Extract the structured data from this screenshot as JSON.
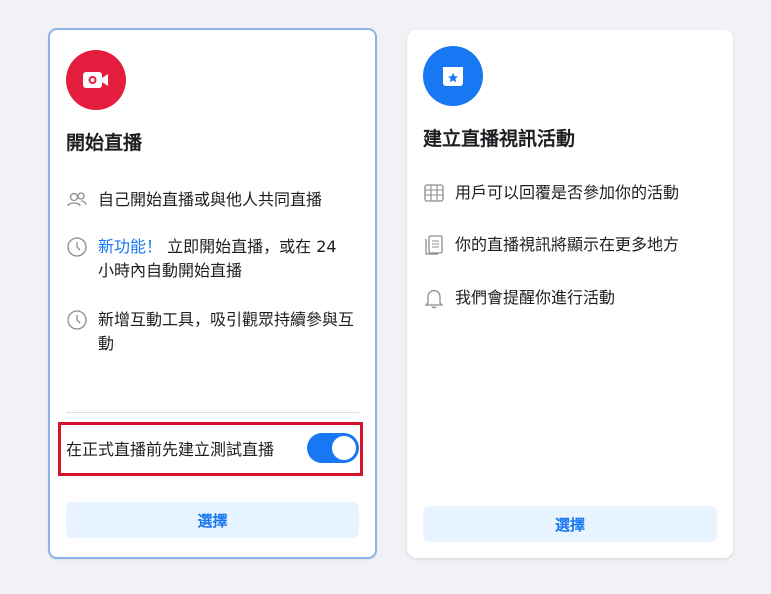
{
  "left_card": {
    "title": "開始直播",
    "features": [
      {
        "icon": "people-icon",
        "text": "自己開始直播或與他人共同直播"
      },
      {
        "icon": "clock-icon",
        "accent": "新功能！",
        "text": " 立即開始直播，或在 24 小時內自動開始直播"
      },
      {
        "icon": "clock-icon",
        "text": "新增互動工具，吸引觀眾持續參與互動"
      }
    ],
    "toggle_label": "在正式直播前先建立測試直播",
    "toggle_on": true,
    "select_label": "選擇"
  },
  "right_card": {
    "title": "建立直播視訊活動",
    "features": [
      {
        "icon": "calendar-grid-icon",
        "text": "用戶可以回覆是否參加你的活動"
      },
      {
        "icon": "pages-icon",
        "text": "你的直播視訊將顯示在更多地方"
      },
      {
        "icon": "bell-icon",
        "text": "我們會提醒你進行活動"
      }
    ],
    "select_label": "選擇"
  },
  "colors": {
    "accent": "#1877f2",
    "live_red": "#e41e3f",
    "highlight": "#d9122c"
  }
}
